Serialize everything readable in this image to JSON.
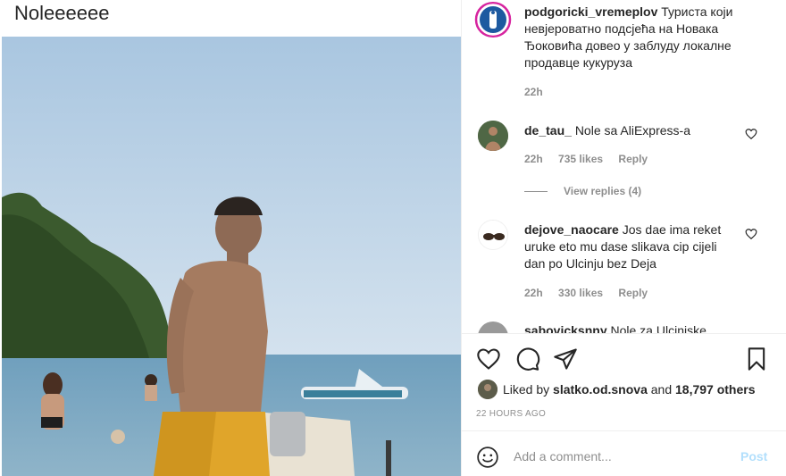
{
  "photo_caption": "Noleeeeee",
  "post": {
    "author": "podgoricki_vremeplov",
    "caption": "Туриста који невјероватно подсјећа на Новака Ђоковића довео у заблуду локалне продавце кукуруза",
    "time": "22h"
  },
  "comments": [
    {
      "user": "de_tau_",
      "text": "Nole sa AliExpress-a",
      "time": "22h",
      "likes": "735 likes",
      "reply": "Reply",
      "view_replies": "View replies (4)"
    },
    {
      "user": "dejove_naocare",
      "text": "Jos dae ima reket uruke eto mu dase slikava cip cijeli dan po Ulcinju bez Deja",
      "time": "22h",
      "likes": "330 likes",
      "reply": "Reply"
    },
    {
      "user": "sabovicksnny",
      "text": "Nole za Ulcinjske"
    }
  ],
  "icons": {
    "like": "heart-icon",
    "comment": "comment-icon",
    "share": "paper-plane-icon",
    "save": "bookmark-icon",
    "emoji": "smiley-icon",
    "comment_like": "heart-outline-icon"
  },
  "likes": {
    "prefix": "Liked by",
    "user": "slatko.od.snova",
    "joiner": "and",
    "others": "18,797 others"
  },
  "timestamp": "22 HOURS AGO",
  "comment_box": {
    "placeholder": "Add a comment...",
    "post_label": "Post"
  },
  "colors": {
    "text": "#262626",
    "muted": "#8e8e8e",
    "post_disabled": "#b2dffc",
    "divider": "#efefef"
  }
}
